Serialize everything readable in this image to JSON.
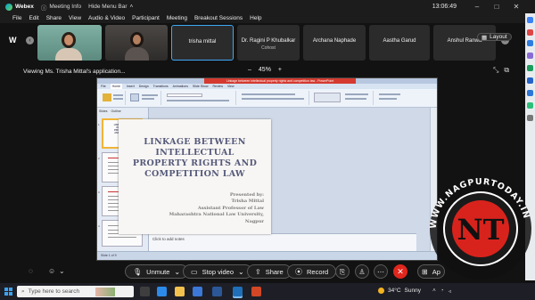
{
  "titlebar": {
    "app_name": "Webex",
    "meeting_info": "Meeting Info",
    "hide_menu_bar": "Hide Menu Bar",
    "time": "13:06:49"
  },
  "menu": [
    "File",
    "Edit",
    "Share",
    "View",
    "Audio & Video",
    "Participant",
    "Meeting",
    "Breakout Sessions",
    "Help"
  ],
  "left_peek_text": "W",
  "participants": [
    {
      "name": "",
      "subtitle": "",
      "video": true
    },
    {
      "name": "",
      "subtitle": "",
      "video": true
    },
    {
      "name": "trisha mittal",
      "subtitle": "",
      "video": false,
      "active": true
    },
    {
      "name": "Dr. Ragini P Khubalkar",
      "subtitle": "Cohost",
      "video": false
    },
    {
      "name": "Archana Naphade",
      "subtitle": "",
      "video": false
    },
    {
      "name": "Aastha Garud",
      "subtitle": "",
      "video": false
    },
    {
      "name": "Anshul Ranwa",
      "subtitle": "",
      "video": false
    }
  ],
  "layout_button": "Layout",
  "viewing_label": "Viewing Ms. Trisha Mittal's application...",
  "zoom": {
    "minus": "–",
    "value": "45%",
    "plus": "+"
  },
  "ppt": {
    "window_title": "Linkage between intellectual property rights and competition law - PowerPoint",
    "tabs": [
      "File",
      "Home",
      "Insert",
      "Design",
      "Transitions",
      "Animations",
      "Slide Show",
      "Review",
      "View"
    ],
    "panel_tabs": [
      "Slides",
      "Outline"
    ],
    "slide_title": "LINKAGE BETWEEN INTELLECTUAL PROPERTY RIGHTS AND COMPETITION LAW",
    "presenter_lines": [
      "Presented by:",
      "Trisha Mittal",
      "Assistant Professor of Law",
      "Maharashtra National Law University,",
      "Nagpur"
    ],
    "thumbnail_title": "LINKAGE BETWEEN INTELLECTUAL PROPERTY RIGHTS AND COMPETITION LAW",
    "notes_placeholder": "Click to add notes",
    "status_slide": "Slide 1 of 9"
  },
  "controls": {
    "unmute": "Unmute",
    "stop_video": "Stop video",
    "share": "Share",
    "record": "Record",
    "apps": "Ap"
  },
  "taskbar": {
    "search_placeholder": "Type here to search",
    "temperature": "34°C",
    "weather": "Sunny"
  },
  "watermark": {
    "text": "WWW.NAGPURTODAY.IN",
    "logo": "NT"
  }
}
